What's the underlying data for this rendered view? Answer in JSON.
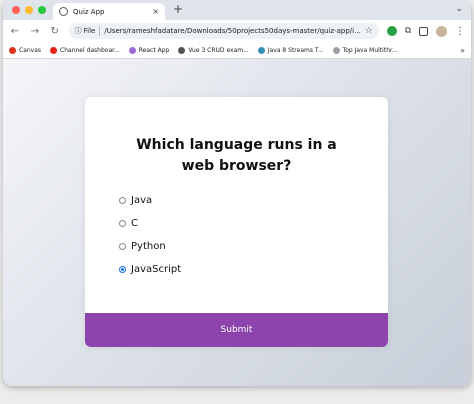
{
  "browser": {
    "tab_title": "Quiz App",
    "tab_close": "×",
    "new_tab": "+",
    "address_chip": "File",
    "address": "/Users/rameshfadatare/Downloads/50projects50days-master/quiz-app/i...",
    "menu_down": "⌄",
    "kebab": "⋮",
    "bookmarks_more": "»"
  },
  "bookmarks": [
    {
      "label": "Canvas",
      "color": "#e0341f"
    },
    {
      "label": "Channel dashboar...",
      "color": "#e62117"
    },
    {
      "label": "React App",
      "color": "#9b6bd6"
    },
    {
      "label": "Vue 3 CRUD exam...",
      "color": "#555555"
    },
    {
      "label": "Java 8 Streams T...",
      "color": "#3a8fb7"
    },
    {
      "label": "Top Java Multithr...",
      "color": "#9aa0a6"
    }
  ],
  "quiz": {
    "question": "Which language runs in a web browser?",
    "answers": [
      {
        "label": "Java",
        "checked": false
      },
      {
        "label": "C",
        "checked": false
      },
      {
        "label": "Python",
        "checked": false
      },
      {
        "label": "JavaScript",
        "checked": true
      }
    ],
    "submit_label": "Submit",
    "accent": "#8e44ad"
  }
}
